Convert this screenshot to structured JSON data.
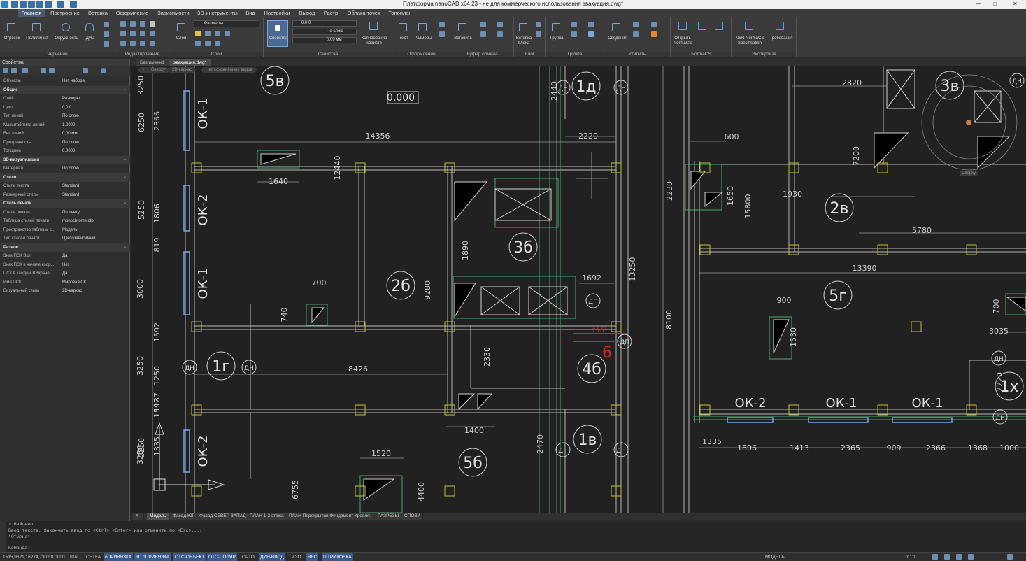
{
  "window": {
    "title": "Платформа nanoCAD x64 23 - не для коммерческого использования эвакуация.dwg*"
  },
  "ribbon_tabs": [
    "Главная",
    "Построение",
    "Вставка",
    "Оформление",
    "Зависимости",
    "3D-инструменты",
    "Вид",
    "Настройки",
    "Вывод",
    "Растр",
    "Облака точек",
    "Топоплан"
  ],
  "ribbon": {
    "draw": {
      "label": "Черчение",
      "buttons": [
        "Отрезок",
        "Полилиния",
        "Окружность",
        "Дуга"
      ]
    },
    "edit": {
      "label": "Редактирование"
    },
    "layers": {
      "label": "Слои",
      "button": "Слои",
      "layer_combo": "Размеры"
    },
    "properties": {
      "label": "Свойства",
      "button": "Свойства",
      "layer": "0,0,0",
      "linetype": "По слою",
      "lineweight": "0,00 мм",
      "copy": "Копирование свойств"
    },
    "annotate": {
      "label": "Оформление",
      "buttons": [
        "Текст",
        "Размеры"
      ]
    },
    "clipboard": {
      "label": "Буфер обмена",
      "buttons": [
        "Вставить"
      ]
    },
    "block": {
      "label": "Блок",
      "buttons": [
        "Вставка блока"
      ]
    },
    "group": {
      "label": "Группа",
      "buttons": [
        "Группа"
      ]
    },
    "utils": {
      "label": "Утилиты",
      "buttons": [
        "Сведения"
      ]
    },
    "normacs": {
      "label": "NormaCS",
      "buttons": [
        "Открыть NormaCS"
      ]
    },
    "expertise": {
      "label": "Экспертиза",
      "buttons": [
        "NSR NormaCS Specification",
        "Требования"
      ]
    }
  },
  "props_panel": {
    "title": "Свойства",
    "objects_label": "Объекты",
    "objects_value": "Нет набора",
    "sections": [
      {
        "name": "Общие",
        "rows": [
          [
            "Слой",
            "Размеры"
          ],
          [
            "Цвет",
            "0,0,0"
          ],
          [
            "Тип линий",
            "По слою"
          ],
          [
            "Масштаб типа линий",
            "1.0000"
          ],
          [
            "Вес линий",
            "0,00 мм"
          ],
          [
            "Прозрачность",
            "По слою"
          ],
          [
            "Толщина",
            "0.0000"
          ]
        ]
      },
      {
        "name": "3D-визуализация",
        "rows": [
          [
            "Материал",
            "По слою"
          ]
        ]
      },
      {
        "name": "Стили",
        "rows": [
          [
            "Стиль текста",
            "Standard"
          ],
          [
            "Размерный стиль",
            "Standard"
          ]
        ]
      },
      {
        "name": "Стиль печати",
        "rows": [
          [
            "Стиль печати",
            "По цвету"
          ],
          [
            "Таблица стилей печати",
            "monochrome.ctb"
          ],
          [
            "Пространство таблицы с...",
            "Модель"
          ],
          [
            "Тип стилей печати",
            "Цветозависимый"
          ]
        ]
      },
      {
        "name": "Разное",
        "rows": [
          [
            "Знак ПСК Вкл",
            "Да"
          ],
          [
            "Знак ПСК в начале коор...",
            "Нет"
          ],
          [
            "ПСК в каждом ВЭкране",
            "Да"
          ],
          [
            "Имя ПСК",
            "Мировая СК"
          ],
          [
            "Визуальный стиль",
            "2D-каркас"
          ]
        ]
      }
    ]
  },
  "doc_tabs": [
    "Без имени1",
    "эвакуация.dwg*"
  ],
  "view_tabs": [
    "Сверху",
    "2D-каркас",
    "Нет сохранённых видов"
  ],
  "layout_tabs": [
    "Модель",
    "Фасад ЮГ",
    "Фасад СЕВЕР ЗАПАД",
    "ПЛАН 1-2 этажа",
    "ПЛАН Перекрытия Фундамент Кровля",
    "РАЗРЕЗЫ",
    "СПОЗУ"
  ],
  "drawing": {
    "rooms": [
      "5в",
      "1д",
      "3в",
      "2б",
      "3б",
      "2в",
      "5г",
      "1г",
      "4б",
      "1в",
      "5б",
      "1х"
    ],
    "labels": [
      "ОК-1",
      "ОК-2",
      "ОК-1",
      "ОК-2",
      "ОК-2",
      "ОК-1",
      "ОК-1"
    ],
    "markers": [
      "ДН",
      "ДН",
      "ДН",
      "ДН",
      "ДН",
      "ДН",
      "ДН",
      "ДН",
      "ДП",
      "ДП",
      "ДН"
    ],
    "dims": [
      "14356",
      "2220",
      "2440",
      "2820",
      "1640",
      "12440",
      "1890",
      "1692",
      "9280",
      "13250",
      "700",
      "740",
      "8426",
      "2330",
      "1400",
      "1520",
      "4400",
      "2470",
      "1930",
      "5780",
      "13390",
      "8100",
      "1650",
      "15800",
      "2230",
      "7200",
      "600",
      "900",
      "1530",
      "3035",
      "2220",
      "700",
      "1806",
      "1413",
      "2365",
      "909",
      "2366",
      "1368",
      "1000",
      "1335",
      "3250",
      "1806",
      "819",
      "3000",
      "1592",
      "3250",
      "1250",
      "3250",
      "1592",
      "6250",
      "2366",
      "5250",
      "1137",
      "1335",
      "6755",
      "3250"
    ],
    "red_dim": "2161",
    "red_mark": "6",
    "text_box": "0.000",
    "view_cube": "Сверху"
  },
  "cmd": {
    "lines": [
      "> Найдено",
      "Ввод текста. Закончить ввод по <Ctrl>+<Enter> или отменить по <Esc>...:",
      "*Отмена*"
    ],
    "prompt": "Команда:"
  },
  "status": {
    "coords": "1515,9621,16274,7302,0.0000",
    "toggles": [
      "ШАГ",
      "СЕТКА",
      "оПРИВЯЗКА",
      "3D оПРИВЯЗКА",
      "ОТС-ОБЪЕКТ",
      "ОТС-ПОЛЯР",
      "ОРТО",
      "ДИН-ВВОД",
      "ИЗО",
      "ВЕС",
      "ШТРИХОВКА"
    ],
    "model": "МОДЕЛЬ",
    "scale": "m1:1"
  }
}
